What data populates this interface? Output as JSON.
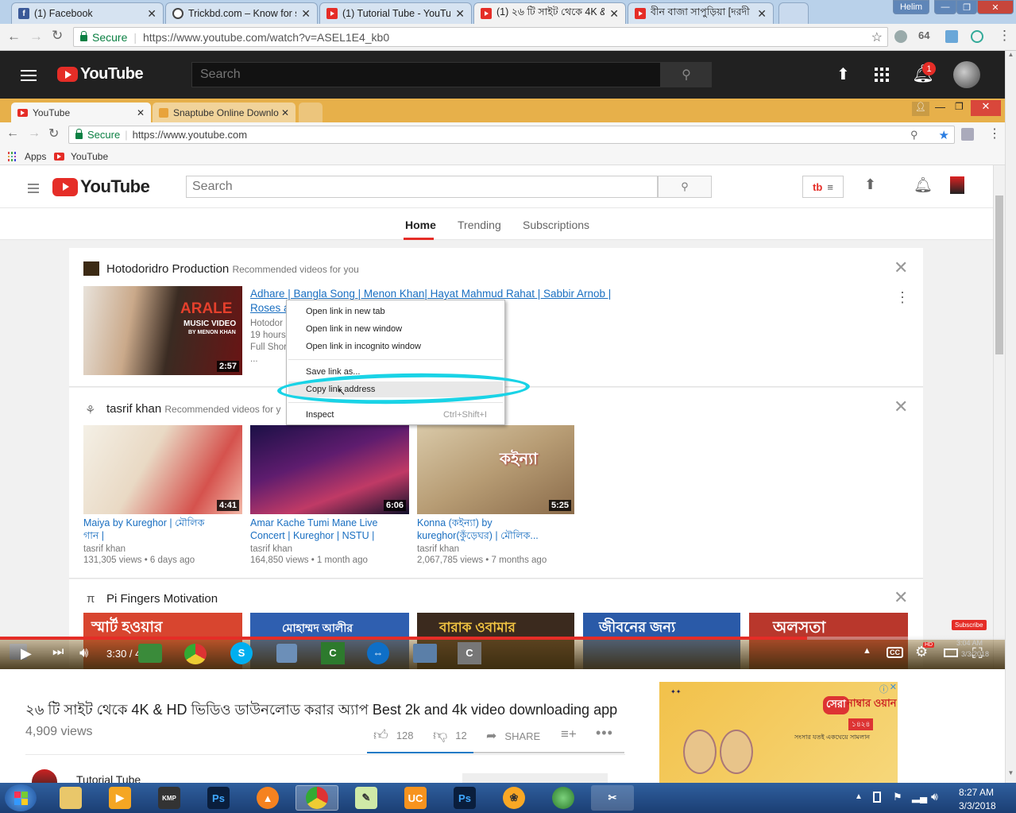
{
  "outer_tabs": [
    {
      "label": "(1) Facebook",
      "icon": "facebook-icon",
      "color": "#3b5998"
    },
    {
      "label": "Trickbd.com – Know for s",
      "icon": "trickbd-icon",
      "color": "#444444"
    },
    {
      "label": "(1) Tutorial Tube - YouTu",
      "icon": "youtube-icon",
      "color": "#e52d27"
    },
    {
      "label": "(1) ২৬ টি সাইট থেকে 4K & H",
      "icon": "youtube-icon",
      "color": "#e52d27"
    },
    {
      "label": "বীন বাজা সাপুড়িয়া [দরদী সন",
      "icon": "youtube-icon",
      "color": "#e52d27"
    }
  ],
  "window_user": "Helim",
  "outer_address": {
    "secure": "Secure",
    "url": "https://www.youtube.com/watch?v=ASEL1E4_kb0"
  },
  "outer_yt": {
    "logo": "YouTube",
    "search_placeholder": "Search",
    "notif_count": "1"
  },
  "inner_tabs": [
    {
      "label": "YouTube"
    },
    {
      "label": "Snaptube Online Downlo"
    }
  ],
  "inner_address": {
    "secure": "Secure",
    "url": "https://www.youtube.com"
  },
  "bookmarks": [
    {
      "label": "Apps"
    },
    {
      "label": "YouTube"
    }
  ],
  "inner_yt": {
    "logo": "YouTube",
    "search_placeholder": "Search"
  },
  "inner_nav": {
    "home": "Home",
    "trending": "Trending",
    "subscriptions": "Subscriptions"
  },
  "shelves": [
    {
      "channel": "Hotodoridro Production",
      "rec": "Recommended videos for you",
      "video": {
        "title_line1": "Adhare | Bangla Song | Menon Khan| Hayat Mahmud Rahat | Sabbir Arnob |",
        "title_line2": "Roses a",
        "meta1": "Hotodor",
        "meta2": "19 hours",
        "meta3": "Full Shor",
        "meta4": "...",
        "duration": "2:57",
        "thumb_text1": "ARALE",
        "thumb_text2": "MUSIC VIDEO",
        "thumb_text3": "BY MENON KHAN"
      }
    },
    {
      "channel": "tasrif khan",
      "rec": "Recommended videos for y",
      "videos": [
        {
          "title1": "Maiya by Kureghor | মৌলিক",
          "title2": "গান |",
          "channel": "tasrif khan",
          "stats": "131,305 views • 6 days ago",
          "duration": "4:41"
        },
        {
          "title1": "Amar Kache Tumi Mane Live",
          "title2": "Concert | Kureghor | NSTU |",
          "channel": "tasrif khan",
          "stats": "164,850 views • 1 month ago",
          "duration": "6:06"
        },
        {
          "title1": "Konna (কইন্যা) by",
          "title2": "kureghor(কুঁড়েঘর) | মৌলিক...",
          "channel": "tasrif khan",
          "stats": "2,067,785 views • 7 months ago",
          "duration": "5:25",
          "thumb_text": "কইন্যা"
        }
      ]
    },
    {
      "channel": "Pi Fingers Motivation",
      "thumbs": [
        "স্মার্ট হওয়ার",
        "মোহাম্মদ আলীর",
        "বারাক ওবামার",
        "জীবনের জন্য",
        "অলসতা"
      ]
    }
  ],
  "context_menu": {
    "items": [
      "Open link in new tab",
      "Open link in new window",
      "Open link in incognito window",
      "Save link as...",
      "Copy link address",
      "Inspect"
    ],
    "inspect_shortcut": "Ctrl+Shift+I"
  },
  "player": {
    "time": "3:30 / 4:22",
    "progress_fraction": 0.803,
    "subscribe": "Subscribe",
    "clock": "3:04 AM",
    "date": "3/3/2018",
    "hd": "HD"
  },
  "video_info": {
    "title": "২৬ টি সাইট থেকে 4K & HD ভিডিও ডাউনলোড করার অ্যাপ Best 2k and 4k video downloading app",
    "views": "4,909 views",
    "likes": "128",
    "dislikes": "12",
    "share": "SHARE",
    "channel": "Tutorial Tube"
  },
  "ad": {
    "text1": "সেরা",
    "text2": "নাম্বার ওয়ান",
    "text3": "১৪২৪",
    "text4": "সংসার যতই একঘেয়ে সামলান"
  },
  "taskbar": {
    "time": "8:27 AM",
    "date": "3/3/2018"
  }
}
